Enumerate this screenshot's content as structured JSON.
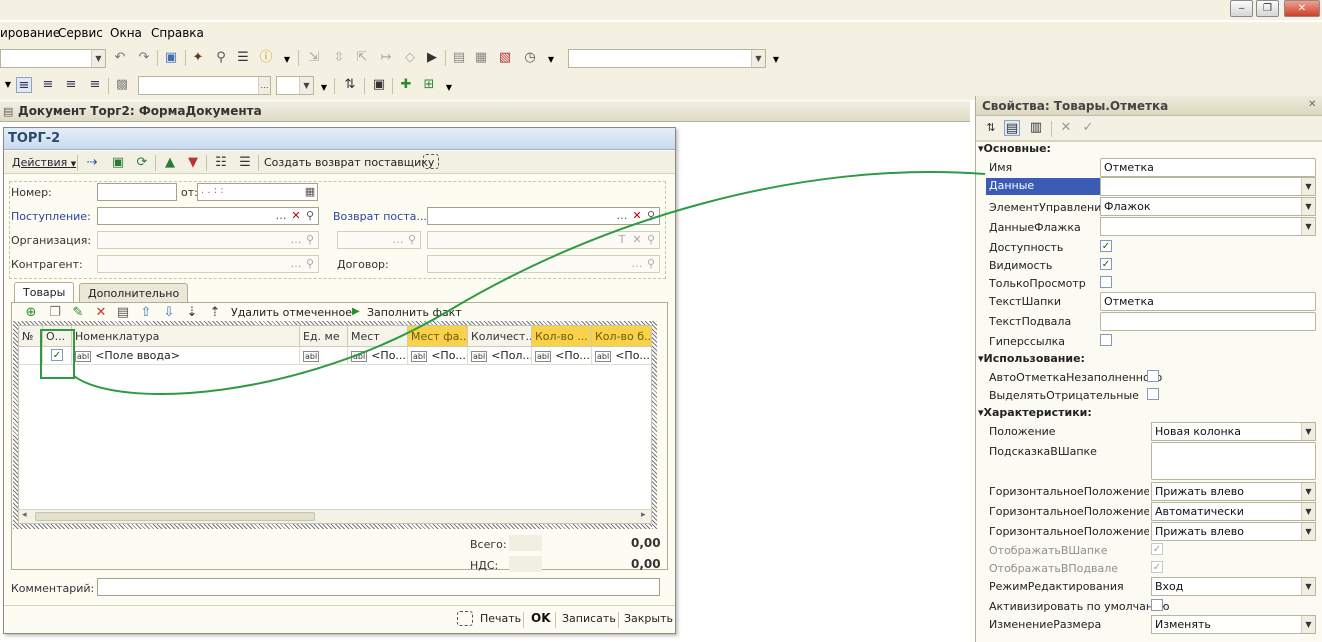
{
  "window": {
    "minimize": "‒",
    "restore": "❐",
    "close": "✕"
  },
  "menu": [
    "ирование",
    "Сервис",
    "Окна",
    "Справка"
  ],
  "document_window": {
    "title": "Документ Торг2: ФормаДокумента"
  },
  "form": {
    "title": "ТОРГ-2",
    "toolbar": {
      "actions": "Действия",
      "create_return": "Создать возврат поставщику"
    },
    "fields": {
      "number": "Номер:",
      "from": "от:",
      "date_placeholder": " .  .      :  :",
      "receipt": "Поступление:",
      "supplier_return": "Возврат поста...",
      "organization": "Организация:",
      "counterparty": "Контрагент:",
      "contract": "Договор:"
    },
    "tabs": [
      "Товары",
      "Дополнительно"
    ],
    "grid_toolbar": {
      "delete_marked": "Удалить отмеченное",
      "fill_fact": "Заполнить факт"
    },
    "columns": [
      "№",
      "О...",
      "Номенклатура",
      "Ед. ме",
      "Мест",
      "Мест фа...",
      "Количест...",
      "Кол-во ...",
      "Кол-во б..."
    ],
    "row": {
      "nomenclature": "<Поле ввода>",
      "unit": "",
      "c1": "<По...",
      "c2": "<По...",
      "c3": "<Пол...",
      "c4": "<По...",
      "c5": "<По..."
    },
    "totals": {
      "total_label": "Всего:",
      "total_value": "0,00",
      "vat_label": "НДС:",
      "vat_value": "0,00"
    },
    "comment": "Комментарий:",
    "bottom_buttons": {
      "print": "Печать",
      "ok": "OK",
      "save": "Записать",
      "close": "Закрыть"
    }
  },
  "properties": {
    "title": "Свойства: Товары.Отметка",
    "sections": {
      "main": "Основные:",
      "usage": "Использование:",
      "characteristics": "Характеристики:"
    },
    "main": [
      {
        "name": "Имя",
        "value": "Отметка"
      },
      {
        "name": "Данные",
        "value": ""
      },
      {
        "name": "ЭлементУправления",
        "value": "Флажок"
      },
      {
        "name": "ДанныеФлажка",
        "value": ""
      },
      {
        "name": "Доступность",
        "value": "✓"
      },
      {
        "name": "Видимость",
        "value": "✓"
      },
      {
        "name": "ТолькоПросмотр",
        "value": ""
      },
      {
        "name": "ТекстШапки",
        "value": "Отметка"
      },
      {
        "name": "ТекстПодвала",
        "value": ""
      },
      {
        "name": "Гиперссылка",
        "value": ""
      }
    ],
    "usage": [
      {
        "name": "АвтоОтметкаНезаполненного",
        "value": ""
      },
      {
        "name": "ВыделятьОтрицательные",
        "value": ""
      }
    ],
    "characteristics": [
      {
        "name": "Положение",
        "value": "Новая колонка"
      },
      {
        "name": "ПодсказкаВШапке",
        "value": ""
      },
      {
        "name": "ГоризонтальноеПоложениеВШа",
        "value": "Прижать влево"
      },
      {
        "name": "ГоризонтальноеПоложениеВКо",
        "value": "Автоматически"
      },
      {
        "name": "ГоризонтальноеПоложениеВПо",
        "value": "Прижать влево"
      },
      {
        "name": "ОтображатьВШапке",
        "value": "✓"
      },
      {
        "name": "ОтображатьВПодвале",
        "value": "✓"
      },
      {
        "name": "РежимРедактирования",
        "value": "Вход"
      },
      {
        "name": "Активизировать по умолчанию",
        "value": ""
      },
      {
        "name": "ИзменениеРазмера",
        "value": "Изменять"
      }
    ]
  },
  "colors": {
    "highlight": "#3c5bb6",
    "annotation": "#2f9a44",
    "yellow_header": "#f9d24a"
  }
}
